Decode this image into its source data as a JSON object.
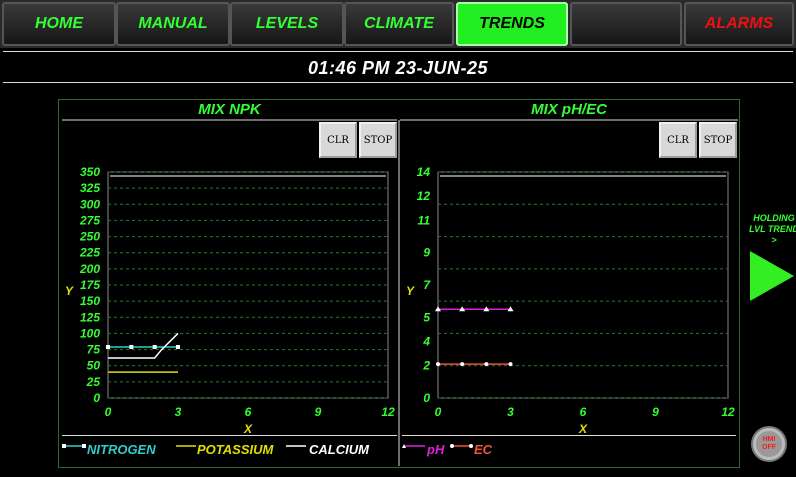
{
  "nav": {
    "tabs": [
      {
        "label": "HOME"
      },
      {
        "label": "MANUAL"
      },
      {
        "label": "LEVELS"
      },
      {
        "label": "CLIMATE"
      },
      {
        "label": "TRENDS"
      },
      {
        "label": ""
      },
      {
        "label": "ALARMS"
      }
    ],
    "active": "TRENDS"
  },
  "clock": {
    "text": "01:46 PM 23-JUN-25"
  },
  "panels": {
    "npk": {
      "title": "MIX NPK",
      "clr_label": "CLR",
      "stop_label": "STOP"
    },
    "phec": {
      "title": "MIX pH/EC",
      "clr_label": "CLR",
      "stop_label": "STOP"
    }
  },
  "side": {
    "holding_text": "HOLDING LVL TREND >"
  },
  "hmi": {
    "line1": "HMI",
    "line2": "OFF"
  },
  "colors": {
    "green": "#33ff33",
    "nitrogen": "#33cccc",
    "potassium": "#e0e000",
    "calcium": "#ffffff",
    "ph": "#dd22dd",
    "ec": "#ee5533"
  },
  "chart_data": [
    {
      "type": "line",
      "title": "MIX NPK",
      "xlabel": "X",
      "ylabel": "Y",
      "xlim": [
        0,
        12
      ],
      "ylim": [
        0,
        350
      ],
      "xticks": [
        0,
        3,
        6,
        9,
        12
      ],
      "yticks": [
        0,
        25,
        50,
        75,
        100,
        125,
        150,
        175,
        200,
        225,
        250,
        275,
        300,
        325,
        350
      ],
      "grid": true,
      "legend_position": "bottom",
      "series": [
        {
          "name": "NITROGEN",
          "x": [
            0,
            1,
            2,
            3
          ],
          "y": [
            79,
            79,
            79,
            79
          ],
          "color": "#33cccc",
          "marker": "square"
        },
        {
          "name": "POTASSIUM",
          "x": [
            0,
            3
          ],
          "y": [
            40,
            40
          ],
          "color": "#e0e000",
          "marker": "none"
        },
        {
          "name": "CALCIUM",
          "x": [
            0,
            1,
            2,
            2.3,
            3
          ],
          "y": [
            62,
            62,
            62,
            75,
            100
          ],
          "color": "#ffffff",
          "marker": "none"
        }
      ]
    },
    {
      "type": "line",
      "title": "MIX pH/EC",
      "xlabel": "X",
      "ylabel": "Y",
      "xlim": [
        0,
        12
      ],
      "ylim": [
        0,
        14
      ],
      "xticks": [
        0,
        3,
        6,
        9,
        12
      ],
      "yticks": [
        0,
        2,
        4,
        6,
        8,
        10,
        12,
        14
      ],
      "ytick_labels": [
        "0",
        "2",
        "4",
        "5",
        "7",
        "9",
        "11",
        "12",
        "14"
      ],
      "ytick_label_values": [
        0,
        2,
        3.5,
        5,
        7,
        9,
        11,
        12.5,
        14
      ],
      "grid": true,
      "legend_position": "bottom",
      "series": [
        {
          "name": "pH",
          "x": [
            0,
            1,
            2,
            3
          ],
          "y": [
            5.5,
            5.5,
            5.5,
            5.5
          ],
          "color": "#dd22dd",
          "marker": "triangle"
        },
        {
          "name": "EC",
          "x": [
            0,
            1,
            2,
            3
          ],
          "y": [
            2.1,
            2.1,
            2.1,
            2.1
          ],
          "color": "#ee5533",
          "marker": "circle"
        }
      ]
    }
  ]
}
